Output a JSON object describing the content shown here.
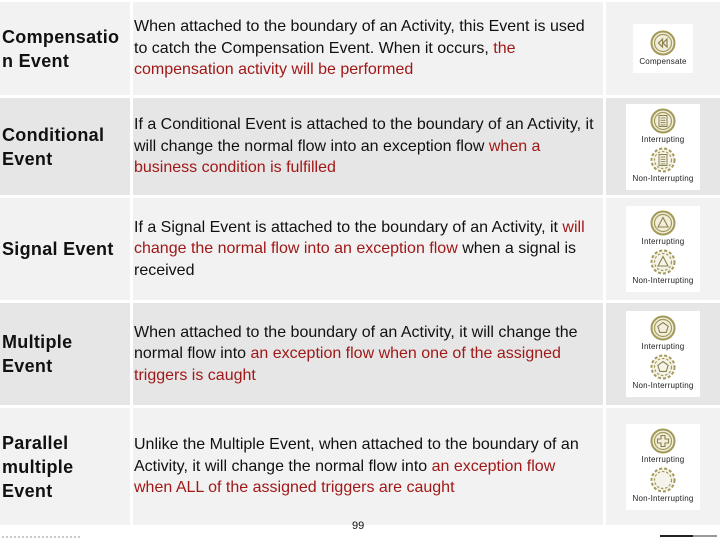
{
  "rows": [
    {
      "name": "Compensation Event",
      "name_lines": [
        "Compensatio",
        "n Event"
      ],
      "desc": [
        {
          "text": "When attached to the boundary of an Activity, this Event is used to catch the Compensation Event. When it occurs, ",
          "hl": false
        },
        {
          "text": "the compensation activity will be performed",
          "hl": true
        }
      ],
      "icons": [
        {
          "symbol": "compensate",
          "label": "Compensate",
          "style": "solid"
        }
      ]
    },
    {
      "name": "Conditional Event",
      "name_lines": [
        "Conditional",
        "Event"
      ],
      "desc": [
        {
          "text": "If a Conditional Event is attached to the boundary of an Activity, it will change the normal flow into an exception flow ",
          "hl": false
        },
        {
          "text": "when a business condition is fulfilled",
          "hl": true
        }
      ],
      "icons": [
        {
          "symbol": "conditional",
          "label": "Interrupting",
          "style": "solid"
        },
        {
          "symbol": "conditional",
          "label": "Non-Interrupting",
          "style": "dashed"
        }
      ]
    },
    {
      "name": "Signal Event",
      "name_lines": [
        "Signal Event"
      ],
      "desc": [
        {
          "text": "If a Signal Event is attached to the boundary of an Activity, it ",
          "hl": false
        },
        {
          "text": "will change the normal flow into an exception flow",
          "hl": true
        },
        {
          "text": " when a signal is received",
          "hl": false
        }
      ],
      "icons": [
        {
          "symbol": "signal",
          "label": "Interrupting",
          "style": "solid"
        },
        {
          "symbol": "signal",
          "label": "Non-Interrupting",
          "style": "dashed"
        }
      ]
    },
    {
      "name": "Multiple Event",
      "name_lines": [
        "Multiple",
        "Event"
      ],
      "desc": [
        {
          "text": "When attached to the boundary of an Activity, it will change the normal flow into ",
          "hl": false
        },
        {
          "text": "an exception flow when one of the assigned triggers is caught",
          "hl": true
        }
      ],
      "icons": [
        {
          "symbol": "multiple",
          "label": "Interrupting",
          "style": "solid"
        },
        {
          "symbol": "multiple",
          "label": "Non-Interrupting",
          "style": "dashed"
        }
      ]
    },
    {
      "name": "Parallel multiple Event",
      "name_lines": [
        "Parallel",
        "multiple",
        "Event"
      ],
      "desc": [
        {
          "text": "Unlike the Multiple Event, when attached to the boundary of an Activity, it will change the normal flow into ",
          "hl": false
        },
        {
          "text": "an exception flow when ALL of the assigned triggers are caught",
          "hl": true
        }
      ],
      "icons": [
        {
          "symbol": "parallel",
          "label": "Interrupting",
          "style": "solid"
        },
        {
          "symbol": "parallel",
          "label": "Non-Interrupting",
          "style": "dashed"
        }
      ]
    }
  ],
  "page_number": "99",
  "colors": {
    "highlight": "#a01818",
    "icon_stroke": "#a39a5a",
    "row_light": "#f2f2f2",
    "row_dark": "#e6e6e6"
  }
}
